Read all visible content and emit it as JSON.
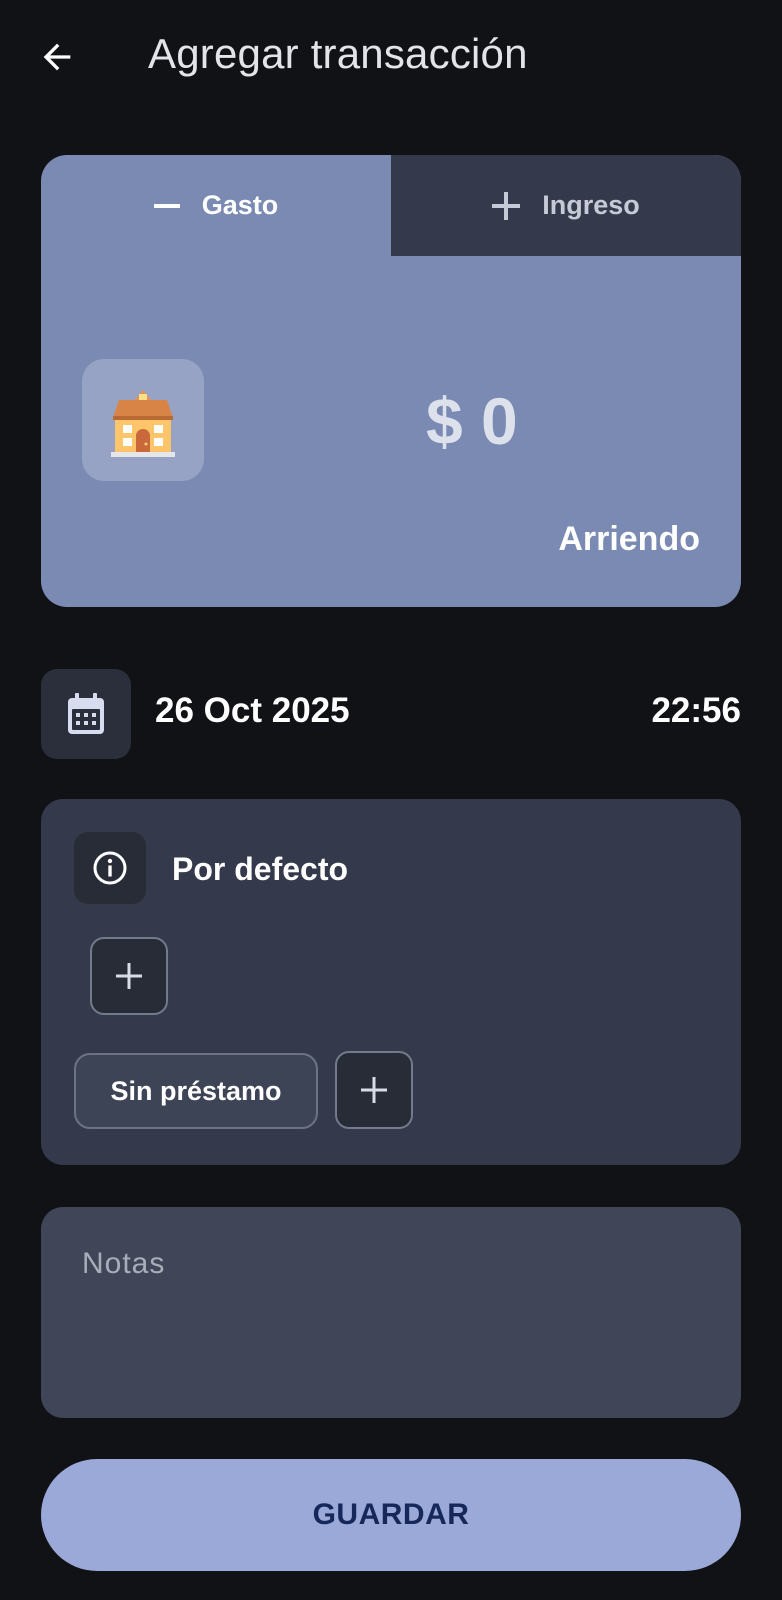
{
  "header": {
    "back_icon": "arrow-left-icon",
    "title": "Agregar transacción"
  },
  "transaction_card": {
    "tabs": [
      {
        "label": "Gasto",
        "icon": "minus-icon",
        "selected": true
      },
      {
        "label": "Ingreso",
        "icon": "plus-icon",
        "selected": false
      }
    ],
    "category_icon": "house-icon",
    "amount": "$ 0",
    "category_name": "Arriendo",
    "color": "#7a8ab3"
  },
  "date_row": {
    "calendar_icon": "calendar-icon",
    "date": "26 Oct 2025",
    "time": "22:56"
  },
  "account_panel": {
    "info_icon": "info-icon",
    "account_name": "Por defecto",
    "add_icon": "plus-icon",
    "loan_chip": "Sin préstamo"
  },
  "notes": {
    "placeholder": "Notas"
  },
  "save_button": {
    "label": "GUARDAR",
    "color": "#9aa9d8"
  }
}
